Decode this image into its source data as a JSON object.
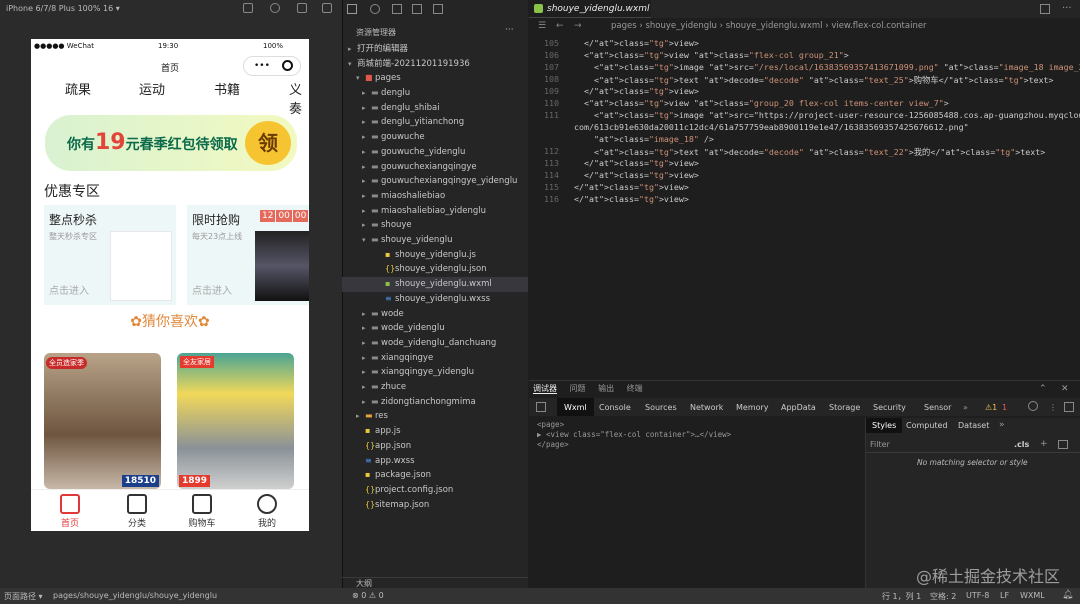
{
  "simulator": {
    "device": "iPhone 6/7/8 Plus 100% 16 ▾",
    "status_left": "●●●●● WeChat",
    "status_time": "19:30",
    "status_right": "100%",
    "nav_title": "首页",
    "capsule_more": "•••",
    "categories": [
      "疏果",
      "运动",
      "书籍",
      "义奏"
    ],
    "banner": {
      "pre": "你有",
      "num": "19",
      "post": "元春季红包待领取",
      "badge": "领"
    },
    "section_title": "优惠专区",
    "card1": {
      "title": "整点秒杀",
      "sub": "整天秒杀专区",
      "go": "点击进入"
    },
    "card2": {
      "title": "限时抢购",
      "sub": "每天23点上线",
      "go": "点击进入",
      "timer": [
        "12",
        "00",
        "00"
      ]
    },
    "guess": "✿猜你喜欢✿",
    "sofa1": {
      "badge": "全员造家季",
      "price": "18510"
    },
    "sofa2": {
      "badge": "全友家居",
      "price": "1899"
    },
    "tabs": [
      "首页",
      "分类",
      "购物车",
      "我的"
    ]
  },
  "explorer": {
    "title": "资源管理器",
    "more": "···",
    "open_editors": "打开的编辑器",
    "project": "商城前端-20211201191936",
    "pages": "pages",
    "folders": [
      "denglu",
      "denglu_shibai",
      "denglu_yitianchong",
      "gouwuche",
      "gouwuche_yidenglu",
      "gouwuchexiangqingye",
      "gouwuchexiangqingye_yidenglu",
      "miaoshaliebiao",
      "miaoshaliebiao_yidenglu",
      "shouye",
      "shouye_yidenglu"
    ],
    "sub_files": [
      "shouye_yidenglu.js",
      "shouye_yidenglu.json",
      "shouye_yidenglu.wxml",
      "shouye_yidenglu.wxss"
    ],
    "folders2": [
      "wode",
      "wode_yidenglu",
      "wode_yidenglu_danchuang",
      "xiangqingye",
      "xiangqingye_yidenglu",
      "zhuce",
      "zidongtianchongmima"
    ],
    "root_files": [
      "res",
      "app.js",
      "app.json",
      "app.wxss",
      "package.json",
      "project.config.json",
      "sitemap.json"
    ],
    "outline": "大纲"
  },
  "editor": {
    "tab": "shouye_yidenglu.wxml",
    "breadcrumb": "pages › shouye_yidenglu ›  shouye_yidenglu.wxml ›  view.flex-col.container",
    "line_numbers": [
      "105",
      "106",
      "107",
      "108",
      "109",
      "110",
      "111",
      "",
      "",
      "112",
      "113",
      "114",
      "115",
      "116"
    ],
    "lines": [
      "  </view>",
      "  <view class=\"flex-col group_21\">",
      "    <image src=\"/res/local/16383569357413671099.png\" class=\"image_18 image_21\" />",
      "    <text decode=\"decode\" class=\"text_25\">购物车</text>",
      "  </view>",
      "  <view class=\"group_20 flex-col items-center view_7\">",
      "    <image src=\"https://project-user-resource-1256085488.cos.ap-guangzhou.myqcloud.",
      "com/613cb91e630da20011c12dc4/61a757759eab8900119e1e47/16383569357425676612.png\"",
      "    class=\"image_18\" />",
      "    <text decode=\"decode\" class=\"text_22\">我的</text>",
      "  </view>",
      "  </view>",
      "</view>",
      "</view>"
    ]
  },
  "debugger": {
    "top_tabs": [
      "调试器",
      "问题",
      "输出",
      "终端"
    ],
    "dev_tabs": [
      "Wxml",
      "Console",
      "Sources",
      "Network",
      "Memory",
      "AppData",
      "Storage",
      "Security",
      "Sensor"
    ],
    "warn": "⚠1",
    "err": "1",
    "tree": [
      "<page>",
      "▶ <view class=\"flex-col container\">…</view>",
      "</page>"
    ],
    "styles_tabs": [
      "Styles",
      "Computed",
      "Dataset"
    ],
    "filter": "Filter",
    "cls": ".cls",
    "no_match": "No matching selector or style"
  },
  "statusbar": {
    "path_label": "页面路径 ▾",
    "path": "pages/shouye_yidenglu/shouye_yidenglu",
    "errors": "⊗ 0 ⚠ 0",
    "pos": "行 1，列 1",
    "spaces": "空格: 2",
    "enc": "UTF-8",
    "eol": "LF",
    "lang": "WXML"
  },
  "watermark": "@稀土掘金技术社区"
}
